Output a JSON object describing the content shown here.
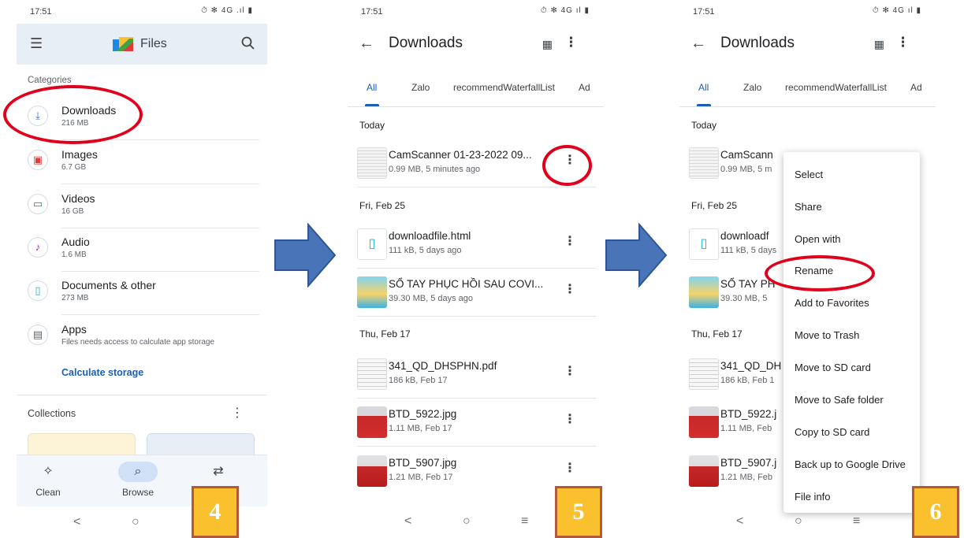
{
  "screen1": {
    "time": "17:51",
    "status_icons": "⏱ ✻ 4G .ıl ▮",
    "app_title": "Files",
    "categories_label": "Categories",
    "categories": [
      {
        "name": "Downloads",
        "size": "216 MB",
        "icon": "download-icon",
        "color": "#1a73e8"
      },
      {
        "name": "Images",
        "size": "6.7 GB",
        "icon": "image-icon",
        "color": "#e53935"
      },
      {
        "name": "Videos",
        "size": "16 GB",
        "icon": "video-icon",
        "color": "#0f9d58"
      },
      {
        "name": "Audio",
        "size": "1.6 MB",
        "icon": "audio-icon",
        "color": "#9c27b0"
      },
      {
        "name": "Documents & other",
        "size": "273 MB",
        "icon": "document-icon",
        "color": "#12b5cb"
      },
      {
        "name": "Apps",
        "size": "Files needs access to calculate app storage",
        "icon": "apps-icon",
        "color": "#5f6368"
      }
    ],
    "calculate_storage": "Calculate storage",
    "collections_label": "Collections",
    "bottom_nav": [
      {
        "label": "Clean",
        "icon": "sparkle-icon"
      },
      {
        "label": "Browse",
        "icon": "browse-icon"
      },
      {
        "label": "",
        "icon": "share-arrows-icon"
      }
    ],
    "badge": "4"
  },
  "screen2": {
    "time": "17:51",
    "status_icons": "⏱ ✻ 4G ıl ▮",
    "title": "Downloads",
    "tabs": [
      "All",
      "Zalo",
      "recommendWaterfallList",
      "Ad"
    ],
    "sections": [
      "Today",
      "Fri, Feb 25",
      "Thu, Feb 17"
    ],
    "files": [
      {
        "name": "CamScanner 01-23-2022 09...",
        "meta": "0.99 MB, 5 minutes ago",
        "thumb": "doc"
      },
      {
        "name": "downloadfile.html",
        "meta": "111 kB, 5 days ago",
        "thumb": "html"
      },
      {
        "name": "SỔ TAY PHỤC HỒI SAU COVI...",
        "meta": "39.30 MB, 5 days ago",
        "thumb": "book"
      },
      {
        "name": "341_QD_DHSPHN.pdf",
        "meta": "186 kB, Feb 17",
        "thumb": "pdf"
      },
      {
        "name": "BTD_5922.jpg",
        "meta": "1.11 MB, Feb 17",
        "thumb": "photo"
      },
      {
        "name": "BTD_5907.jpg",
        "meta": "1.21 MB, Feb 17",
        "thumb": "photo2"
      }
    ],
    "badge": "5"
  },
  "screen3": {
    "time": "17:51",
    "status_icons": "⏱ ✻ 4G ıl ▮",
    "title": "Downloads",
    "tabs": [
      "All",
      "Zalo",
      "recommendWaterfallList",
      "Ad"
    ],
    "sections": [
      "Today",
      "Fri, Feb 25",
      "Thu, Feb 17"
    ],
    "files": [
      {
        "name": "CamScann",
        "meta": "0.99 MB, 5 m"
      },
      {
        "name": "downloadf",
        "meta": "111 kB, 5 days"
      },
      {
        "name": "SỔ TAY PH",
        "meta": "39.30 MB, 5"
      },
      {
        "name": "341_QD_DH",
        "meta": "186 kB, Feb 1"
      },
      {
        "name": "BTD_5922.j",
        "meta": "1.11 MB, Feb"
      },
      {
        "name": "BTD_5907.j",
        "meta": "1.21 MB, Feb"
      }
    ],
    "menu": [
      "Select",
      "Share",
      "Open with",
      "Rename",
      "Add to Favorites",
      "Move to Trash",
      "Move to SD card",
      "Move to Safe folder",
      "Copy to SD card",
      "Back up to Google Drive",
      "File info"
    ],
    "badge": "6"
  },
  "colors": {
    "accent": "#1a5fb4",
    "highlight_oval": "#e0001b",
    "arrow": "#4a74b8",
    "badge_fill": "#fbc02d",
    "badge_border": "#b05a3c"
  }
}
